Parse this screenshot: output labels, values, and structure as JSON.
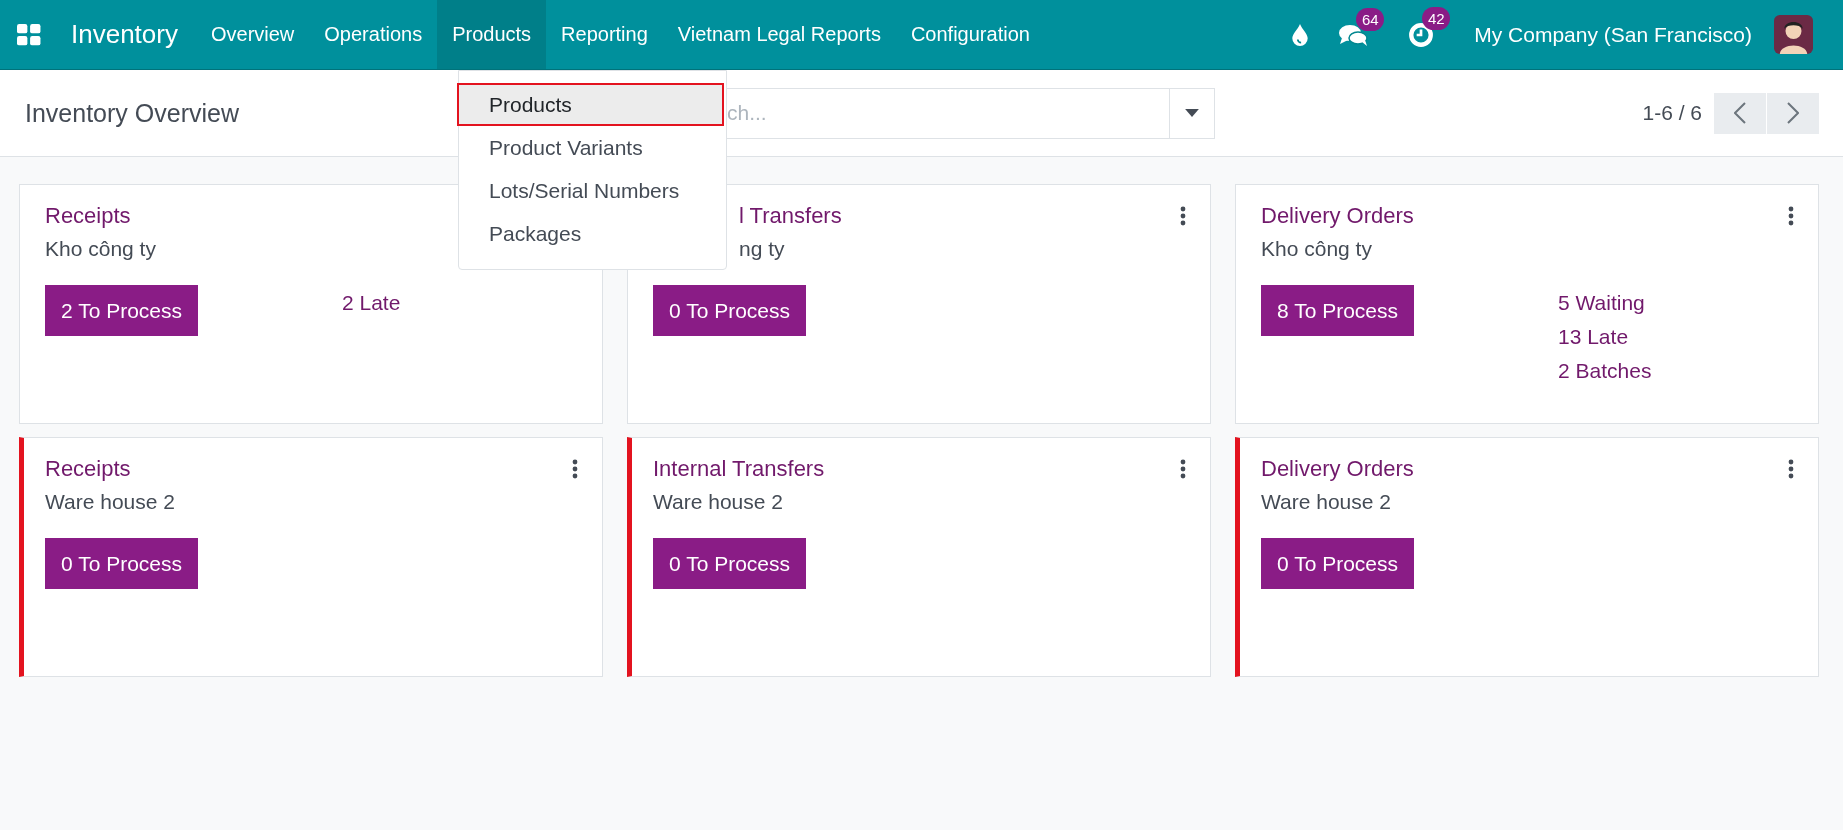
{
  "app_name": "Inventory",
  "menu": [
    {
      "label": "Overview",
      "selected": false
    },
    {
      "label": "Operations",
      "selected": false
    },
    {
      "label": "Products",
      "selected": true
    },
    {
      "label": "Reporting",
      "selected": false
    },
    {
      "label": "Vietnam Legal Reports",
      "selected": false
    },
    {
      "label": "Configuration",
      "selected": false
    }
  ],
  "systray": {
    "messages_count": "64",
    "activities_count": "42",
    "company": "My Company (San Francisco)"
  },
  "dropdown": {
    "items": [
      {
        "label": "Products",
        "selected": true
      },
      {
        "label": "Product Variants",
        "selected": false
      },
      {
        "label": "Lots/Serial Numbers",
        "selected": false
      },
      {
        "label": "Packages",
        "selected": false
      }
    ]
  },
  "page_title": "Inventory Overview",
  "search": {
    "placeholder": "ch..."
  },
  "pager": "1-6 / 6",
  "cards": [
    {
      "title": "Receipts",
      "warehouse": "Kho công ty",
      "button": "2 To Process",
      "stats": [
        "2 Late"
      ],
      "alert": false
    },
    {
      "title": "l Transfers",
      "warehouse": "ng ty",
      "button": "0 To Process",
      "alert": false
    },
    {
      "title": "Delivery Orders",
      "warehouse": "Kho công ty",
      "button": "8 To Process",
      "stats": [
        "5 Waiting",
        "13 Late",
        "2 Batches"
      ],
      "alert": false
    },
    {
      "title": "Receipts",
      "warehouse": "Ware house 2",
      "button": "0 To Process",
      "alert": true
    },
    {
      "title": "Internal Transfers",
      "warehouse": "Ware house 2",
      "button": "0 To Process",
      "alert": true
    },
    {
      "title": "Delivery Orders",
      "warehouse": "Ware house 2",
      "button": "0 To Process",
      "alert": true
    }
  ]
}
